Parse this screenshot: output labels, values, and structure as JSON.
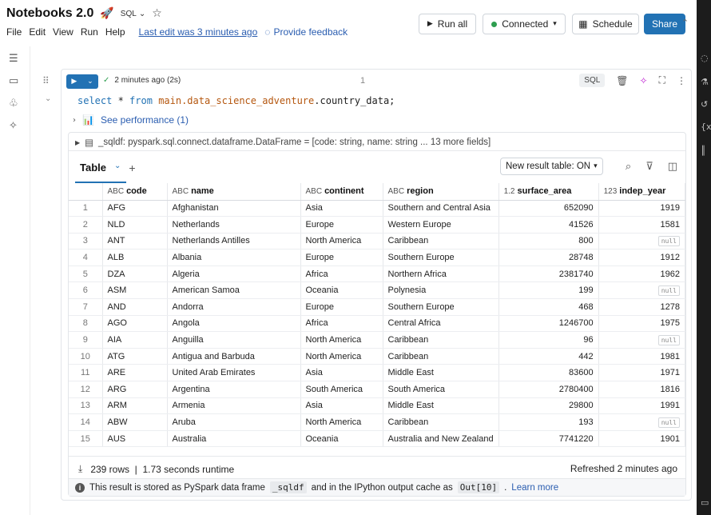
{
  "header": {
    "title": "Notebooks 2.0",
    "title_emoji": "🚀",
    "language": "SQL",
    "menu": [
      "File",
      "Edit",
      "View",
      "Run",
      "Help"
    ],
    "last_edit": "Last edit was 3 minutes ago",
    "feedback": "Provide feedback",
    "run_all": "Run all",
    "connected": "Connected",
    "schedule": "Schedule",
    "share": "Share"
  },
  "cell": {
    "status": "2 minutes ago (2s)",
    "number": "1",
    "lang_badge": "SQL",
    "code": {
      "kw1": "select",
      "star": " * ",
      "kw2": "from",
      "table": "main.data_science_adventure",
      "rest": ".country_data;"
    },
    "performance": "See performance (1)"
  },
  "output": {
    "df_desc": "_sqldf:  pyspark.sql.connect.dataframe.DataFrame = [code: string, name: string ... 13 more fields]",
    "tab_label": "Table",
    "new_result_table": "New result table: ON",
    "columns": [
      {
        "type": "ABC",
        "name": "code"
      },
      {
        "type": "ABC",
        "name": "name"
      },
      {
        "type": "ABC",
        "name": "continent"
      },
      {
        "type": "ABC",
        "name": "region"
      },
      {
        "type": "1.2",
        "name": "surface_area"
      },
      {
        "type": "123",
        "name": "indep_year"
      }
    ],
    "rows": [
      [
        "1",
        "AFG",
        "Afghanistan",
        "Asia",
        "Southern and Central Asia",
        "652090",
        "1919"
      ],
      [
        "2",
        "NLD",
        "Netherlands",
        "Europe",
        "Western Europe",
        "41526",
        "1581"
      ],
      [
        "3",
        "ANT",
        "Netherlands Antilles",
        "North America",
        "Caribbean",
        "800",
        "null"
      ],
      [
        "4",
        "ALB",
        "Albania",
        "Europe",
        "Southern Europe",
        "28748",
        "1912"
      ],
      [
        "5",
        "DZA",
        "Algeria",
        "Africa",
        "Northern Africa",
        "2381740",
        "1962"
      ],
      [
        "6",
        "ASM",
        "American Samoa",
        "Oceania",
        "Polynesia",
        "199",
        "null"
      ],
      [
        "7",
        "AND",
        "Andorra",
        "Europe",
        "Southern Europe",
        "468",
        "1278"
      ],
      [
        "8",
        "AGO",
        "Angola",
        "Africa",
        "Central Africa",
        "1246700",
        "1975"
      ],
      [
        "9",
        "AIA",
        "Anguilla",
        "North America",
        "Caribbean",
        "96",
        "null"
      ],
      [
        "10",
        "ATG",
        "Antigua and Barbuda",
        "North America",
        "Caribbean",
        "442",
        "1981"
      ],
      [
        "11",
        "ARE",
        "United Arab Emirates",
        "Asia",
        "Middle East",
        "83600",
        "1971"
      ],
      [
        "12",
        "ARG",
        "Argentina",
        "South America",
        "South America",
        "2780400",
        "1816"
      ],
      [
        "13",
        "ARM",
        "Armenia",
        "Asia",
        "Middle East",
        "29800",
        "1991"
      ],
      [
        "14",
        "ABW",
        "Aruba",
        "North America",
        "Caribbean",
        "193",
        "null"
      ],
      [
        "15",
        "AUS",
        "Australia",
        "Oceania",
        "Australia and New Zealand",
        "7741220",
        "1901"
      ]
    ],
    "footer_rows": "239 rows  |  1.73 seconds runtime",
    "refreshed": "Refreshed 2 minutes ago",
    "info": {
      "pre": "This result is stored as PySpark data frame",
      "df": "_sqldf",
      "mid": "and in the IPython output cache as",
      "cache": "Out[10]",
      "post": ".",
      "link": "Learn more"
    }
  }
}
